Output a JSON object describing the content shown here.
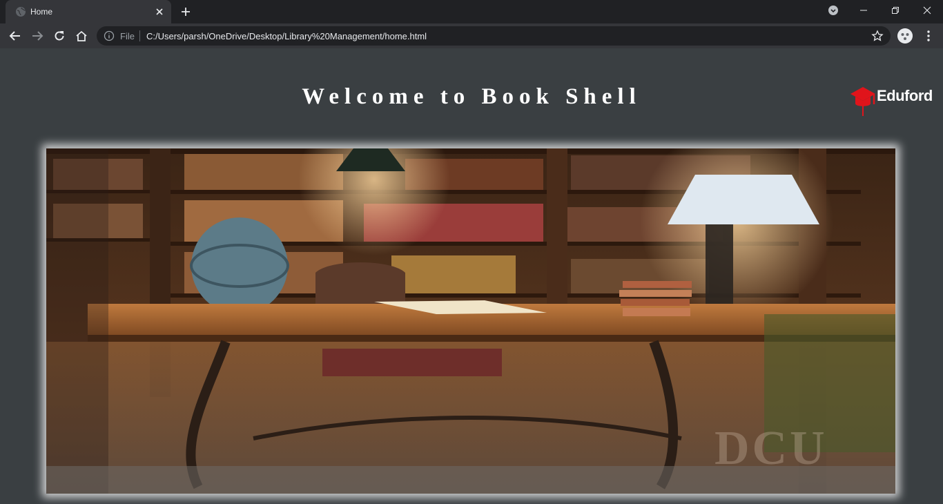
{
  "browser": {
    "tab_title": "Home",
    "address_prefix": "File",
    "url": "C:/Users/parsh/OneDrive/Desktop/Library%20Management/home.html"
  },
  "page": {
    "heading": "Welcome to Book Shell",
    "logo_text": "Eduford",
    "hero_watermark": "DCU"
  },
  "colors": {
    "logo_icon": "#e0141b",
    "page_background": "#3a3f42"
  }
}
